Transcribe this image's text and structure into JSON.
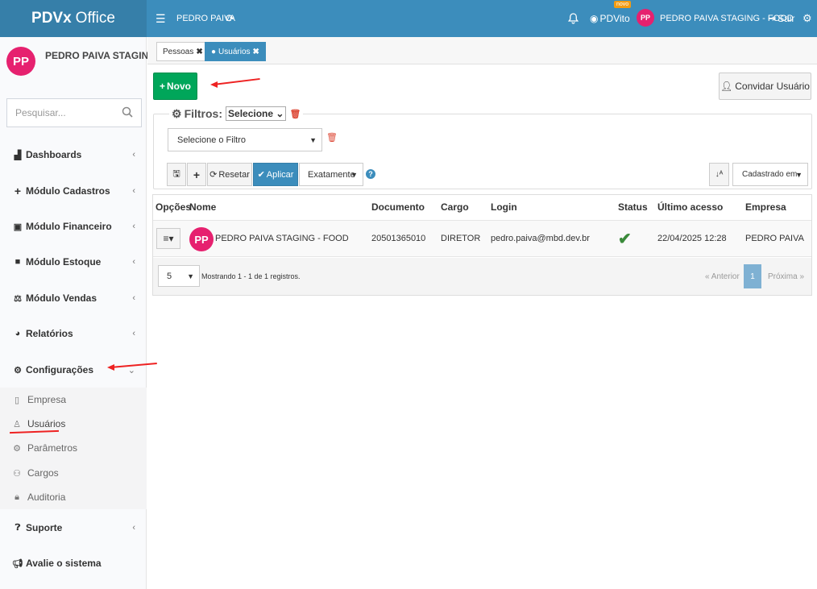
{
  "topbar": {
    "brand_bold": "PDVx",
    "brand_rest": "Office",
    "user": "PEDRO PAIVA",
    "pdvito": "PDVito",
    "novo_badge": "novo",
    "avatar": "PP",
    "company": "PEDRO PAIVA STAGING - FOOD",
    "exit": "Sair"
  },
  "sidebar": {
    "avatar": "PP",
    "name": "PEDRO PAIVA STAGING...",
    "search_placeholder": "Pesquisar...",
    "items": [
      {
        "label": "Dashboards",
        "icon": "area-chart-icon"
      },
      {
        "label": "Módulo Cadastros",
        "icon": "plus-icon"
      },
      {
        "label": "Módulo Financeiro",
        "icon": "money-icon"
      },
      {
        "label": "Módulo Estoque",
        "icon": "box-icon"
      },
      {
        "label": "Módulo Vendas",
        "icon": "balance-scale-icon"
      },
      {
        "label": "Relatórios",
        "icon": "pie-chart-icon"
      },
      {
        "label": "Configurações",
        "icon": "gears-icon"
      },
      {
        "label": "Suporte",
        "icon": "question-circle-icon"
      },
      {
        "label": "Avalie o sistema",
        "icon": "bullhorn-icon"
      }
    ],
    "submenu": [
      {
        "label": "Empresa",
        "icon": "building-icon"
      },
      {
        "label": "Usuários",
        "icon": "user-icon"
      },
      {
        "label": "Parâmetros",
        "icon": "gear-icon"
      },
      {
        "label": "Cargos",
        "icon": "sitemap-icon"
      },
      {
        "label": "Auditoria",
        "icon": "lock-icon"
      }
    ]
  },
  "tabs": [
    {
      "label": "Pessoas"
    },
    {
      "label": "Usuários"
    }
  ],
  "actions": {
    "novo": "Novo",
    "convidar": "Convidar Usuário"
  },
  "filters": {
    "legend": "Filtros:",
    "legend_select": "Selecione",
    "filter_select": "Selecione o Filtro",
    "resetar": "Resetar",
    "aplicar": "Aplicar",
    "match_mode": "Exatamente",
    "sort_by": "Cadastrado em"
  },
  "table": {
    "headers": [
      "Opções",
      "Nome",
      "Documento",
      "Cargo",
      "Login",
      "Status",
      "Último acesso",
      "Empresa"
    ],
    "rows": [
      {
        "avatar": "PP",
        "nome": "PEDRO PAIVA STAGING - FOOD",
        "documento": "20501365010",
        "cargo": "DIRETOR",
        "login": "pedro.paiva@mbd.dev.br",
        "status": "active",
        "ultimo_acesso": "22/04/2025 12:28",
        "empresa": "PEDRO PAIVA"
      }
    ]
  },
  "footer": {
    "page_size": "5",
    "showing": "Mostrando 1 - 1 de 1 registros.",
    "prev": "« Anterior",
    "current": "1",
    "next": "Próxima »"
  },
  "colors": {
    "topbar": "#3c8dbc",
    "brand_bg": "#367fa9",
    "success": "#00a65a",
    "avatar": "#e6216f",
    "annotation": "#ee2222"
  }
}
